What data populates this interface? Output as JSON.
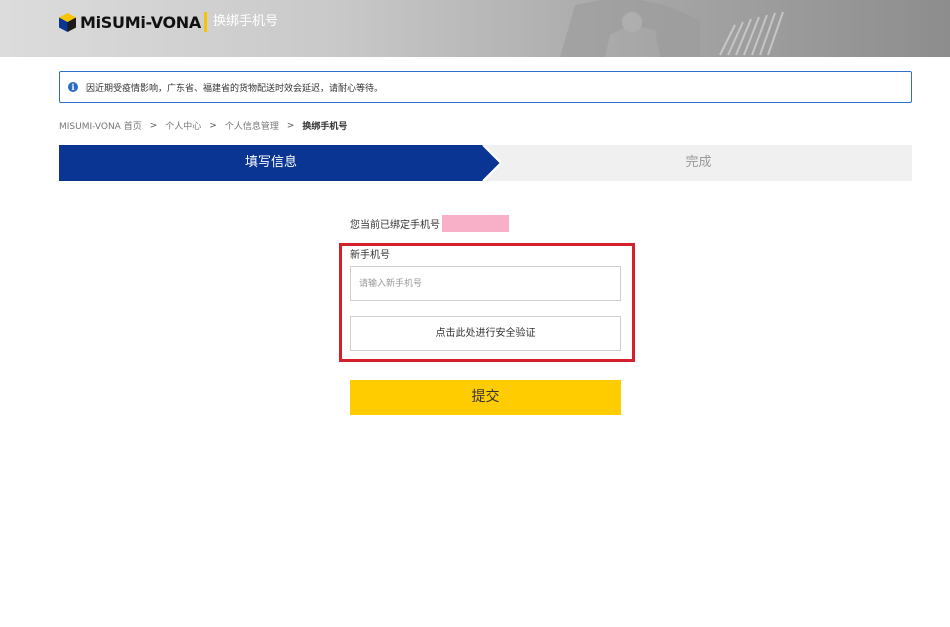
{
  "header": {
    "logo_text": "MiSUMi-VONA",
    "page_title": "换绑手机号"
  },
  "notice": {
    "icon": "info-icon",
    "text": "因近期受疫情影响，广东省、福建省的货物配送时效会延迟，请耐心等待。"
  },
  "breadcrumb": {
    "items": [
      "MISUMI-VONA 首页",
      "个人中心",
      "个人信息管理"
    ],
    "separator": ">",
    "current": "换绑手机号"
  },
  "steps": {
    "active": "填写信息",
    "next": "完成"
  },
  "form": {
    "current_phone_label": "您当前已绑定手机号",
    "new_phone_label": "新手机号",
    "new_phone_placeholder": "请输入新手机号",
    "new_phone_value": "",
    "verify_label": "点击此处进行安全验证",
    "submit_label": "提交"
  },
  "colors": {
    "brand_blue": "#0a3592",
    "accent_yellow": "#ffcc00",
    "highlight_red": "#d4202a",
    "mask_pink": "#f7b0c8"
  }
}
